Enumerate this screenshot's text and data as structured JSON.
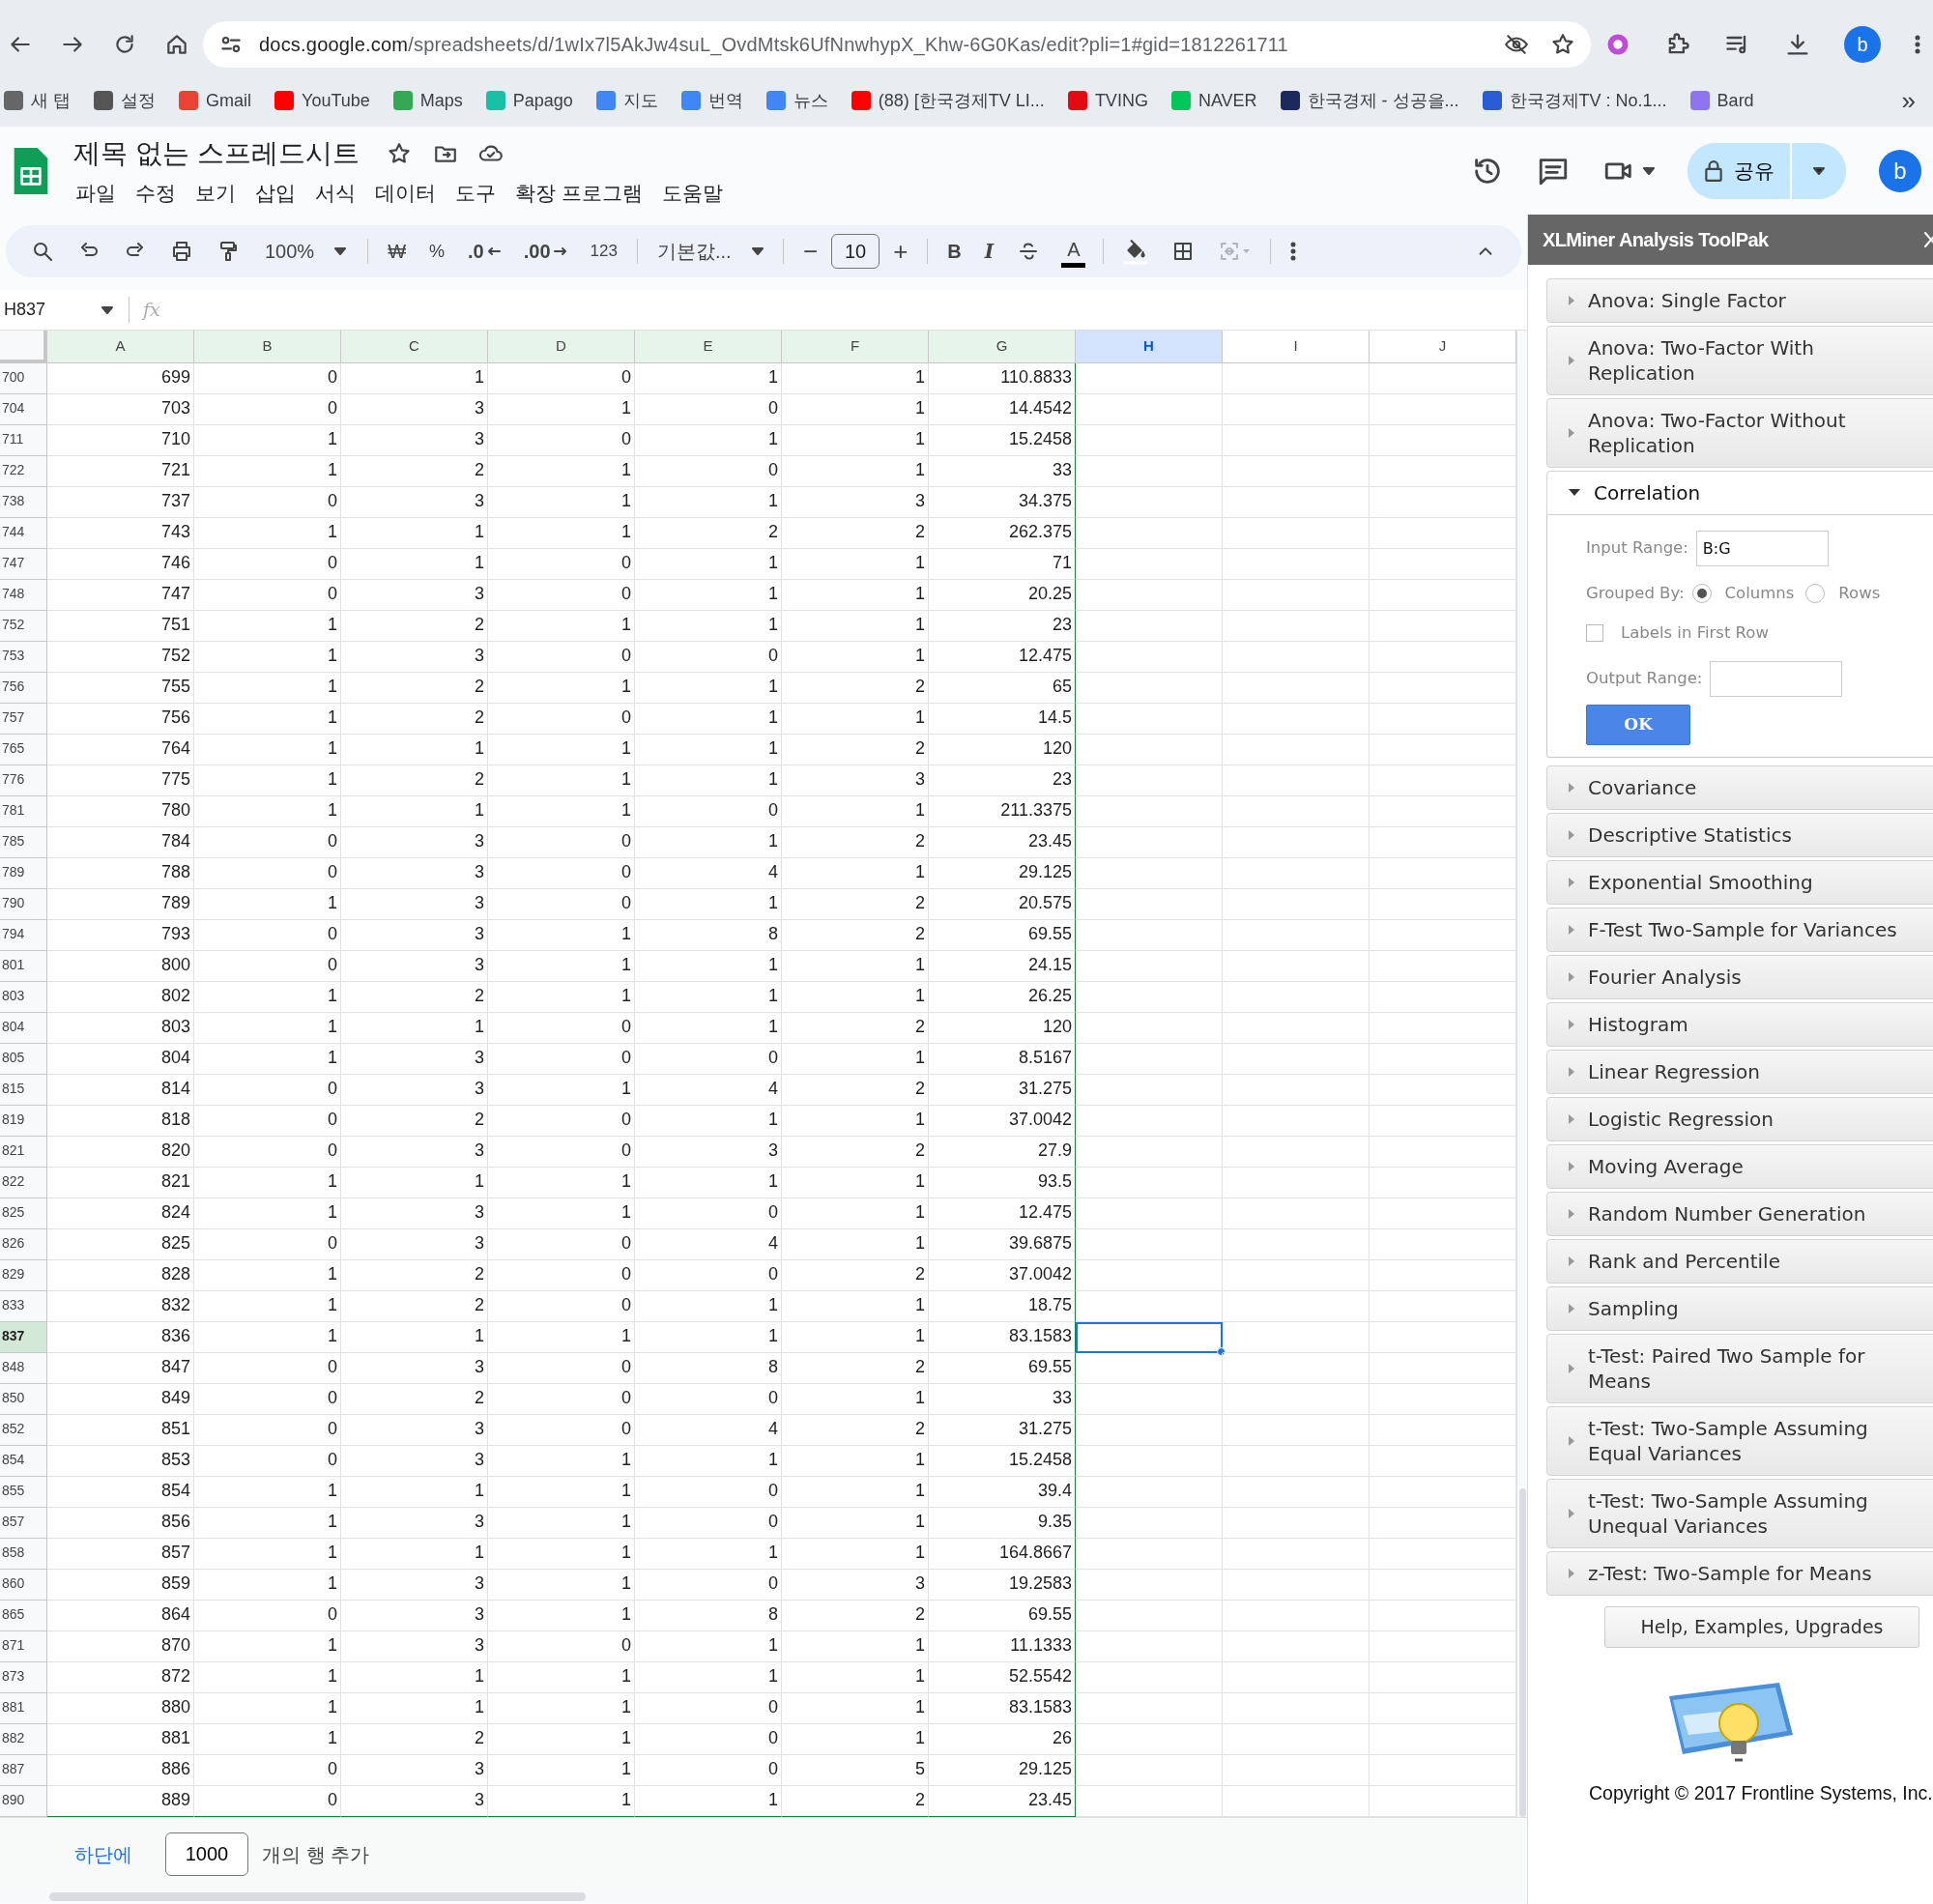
{
  "browser": {
    "url_host": "docs.google.com",
    "url_path": "/spreadsheets/d/1wIx7l5AkJw4suL_OvdMtsk6UfNnwhypX_Khw-6G0Kas/edit?pli=1#gid=1812261711",
    "profile": "b",
    "bookmarks": [
      {
        "label": "새 탭"
      },
      {
        "label": "설정"
      },
      {
        "label": "Gmail"
      },
      {
        "label": "YouTube"
      },
      {
        "label": "Maps"
      },
      {
        "label": "Papago"
      },
      {
        "label": "지도"
      },
      {
        "label": "번역"
      },
      {
        "label": "뉴스"
      },
      {
        "label": "(88) [한국경제TV LI..."
      },
      {
        "label": "TVING"
      },
      {
        "label": "NAVER"
      },
      {
        "label": "한국경제 - 성공을..."
      },
      {
        "label": "한국경제TV : No.1..."
      },
      {
        "label": "Bard"
      }
    ],
    "more": "»"
  },
  "document": {
    "title": "제목 없는 스프레드시트",
    "menu": [
      "파일",
      "수정",
      "보기",
      "삽입",
      "서식",
      "데이터",
      "도구",
      "확장 프로그램",
      "도움말"
    ],
    "share": "공유",
    "avatar": "b"
  },
  "toolbar": {
    "zoom": "100%",
    "currency": "₩",
    "percent": "%",
    "decrease_decimal": ".0",
    "increase_decimal": ".00",
    "number_format": "123",
    "font": "기본값...",
    "minus": "−",
    "font_size": "10",
    "plus": "+",
    "bold": "B",
    "italic": "I",
    "text_color": "A",
    "merge": {
      "disabled": true
    }
  },
  "formula_bar": {
    "cell": "H837",
    "fx": "fx"
  },
  "sheet": {
    "columns": [
      {
        "label": "A",
        "selected": false,
        "filtered": true
      },
      {
        "label": "B",
        "selected": false,
        "filtered": true
      },
      {
        "label": "C",
        "selected": false,
        "filtered": true
      },
      {
        "label": "D",
        "selected": false,
        "filtered": true
      },
      {
        "label": "E",
        "selected": false,
        "filtered": true
      },
      {
        "label": "F",
        "selected": false,
        "filtered": true
      },
      {
        "label": "G",
        "selected": false,
        "filtered": true
      },
      {
        "label": "H",
        "selected": true,
        "filtered": false
      },
      {
        "label": "I",
        "selected": false,
        "filtered": false
      },
      {
        "label": "J",
        "selected": false,
        "filtered": false
      }
    ],
    "rows": [
      {
        "header": "700",
        "selected": false,
        "cells": [
          "699",
          "0",
          "1",
          "0",
          "1",
          "1",
          "110.8833"
        ]
      },
      {
        "header": "704",
        "selected": false,
        "cells": [
          "703",
          "0",
          "3",
          "1",
          "0",
          "1",
          "14.4542"
        ]
      },
      {
        "header": "711",
        "selected": false,
        "cells": [
          "710",
          "1",
          "3",
          "0",
          "1",
          "1",
          "15.2458"
        ]
      },
      {
        "header": "722",
        "selected": false,
        "cells": [
          "721",
          "1",
          "2",
          "1",
          "0",
          "1",
          "33"
        ]
      },
      {
        "header": "738",
        "selected": false,
        "cells": [
          "737",
          "0",
          "3",
          "1",
          "1",
          "3",
          "34.375"
        ]
      },
      {
        "header": "744",
        "selected": false,
        "cells": [
          "743",
          "1",
          "1",
          "1",
          "2",
          "2",
          "262.375"
        ]
      },
      {
        "header": "747",
        "selected": false,
        "cells": [
          "746",
          "0",
          "1",
          "0",
          "1",
          "1",
          "71"
        ]
      },
      {
        "header": "748",
        "selected": false,
        "cells": [
          "747",
          "0",
          "3",
          "0",
          "1",
          "1",
          "20.25"
        ]
      },
      {
        "header": "752",
        "selected": false,
        "cells": [
          "751",
          "1",
          "2",
          "1",
          "1",
          "1",
          "23"
        ]
      },
      {
        "header": "753",
        "selected": false,
        "cells": [
          "752",
          "1",
          "3",
          "0",
          "0",
          "1",
          "12.475"
        ]
      },
      {
        "header": "756",
        "selected": false,
        "cells": [
          "755",
          "1",
          "2",
          "1",
          "1",
          "2",
          "65"
        ]
      },
      {
        "header": "757",
        "selected": false,
        "cells": [
          "756",
          "1",
          "2",
          "0",
          "1",
          "1",
          "14.5"
        ]
      },
      {
        "header": "765",
        "selected": false,
        "cells": [
          "764",
          "1",
          "1",
          "1",
          "1",
          "2",
          "120"
        ]
      },
      {
        "header": "776",
        "selected": false,
        "cells": [
          "775",
          "1",
          "2",
          "1",
          "1",
          "3",
          "23"
        ]
      },
      {
        "header": "781",
        "selected": false,
        "cells": [
          "780",
          "1",
          "1",
          "1",
          "0",
          "1",
          "211.3375"
        ]
      },
      {
        "header": "785",
        "selected": false,
        "cells": [
          "784",
          "0",
          "3",
          "0",
          "1",
          "2",
          "23.45"
        ]
      },
      {
        "header": "789",
        "selected": false,
        "cells": [
          "788",
          "0",
          "3",
          "0",
          "4",
          "1",
          "29.125"
        ]
      },
      {
        "header": "790",
        "selected": false,
        "cells": [
          "789",
          "1",
          "3",
          "0",
          "1",
          "2",
          "20.575"
        ]
      },
      {
        "header": "794",
        "selected": false,
        "cells": [
          "793",
          "0",
          "3",
          "1",
          "8",
          "2",
          "69.55"
        ]
      },
      {
        "header": "801",
        "selected": false,
        "cells": [
          "800",
          "0",
          "3",
          "1",
          "1",
          "1",
          "24.15"
        ]
      },
      {
        "header": "803",
        "selected": false,
        "cells": [
          "802",
          "1",
          "2",
          "1",
          "1",
          "1",
          "26.25"
        ]
      },
      {
        "header": "804",
        "selected": false,
        "cells": [
          "803",
          "1",
          "1",
          "0",
          "1",
          "2",
          "120"
        ]
      },
      {
        "header": "805",
        "selected": false,
        "cells": [
          "804",
          "1",
          "3",
          "0",
          "0",
          "1",
          "8.5167"
        ]
      },
      {
        "header": "815",
        "selected": false,
        "cells": [
          "814",
          "0",
          "3",
          "1",
          "4",
          "2",
          "31.275"
        ]
      },
      {
        "header": "819",
        "selected": false,
        "cells": [
          "818",
          "0",
          "2",
          "0",
          "1",
          "1",
          "37.0042"
        ]
      },
      {
        "header": "821",
        "selected": false,
        "cells": [
          "820",
          "0",
          "3",
          "0",
          "3",
          "2",
          "27.9"
        ]
      },
      {
        "header": "822",
        "selected": false,
        "cells": [
          "821",
          "1",
          "1",
          "1",
          "1",
          "1",
          "93.5"
        ]
      },
      {
        "header": "825",
        "selected": false,
        "cells": [
          "824",
          "1",
          "3",
          "1",
          "0",
          "1",
          "12.475"
        ]
      },
      {
        "header": "826",
        "selected": false,
        "cells": [
          "825",
          "0",
          "3",
          "0",
          "4",
          "1",
          "39.6875"
        ]
      },
      {
        "header": "829",
        "selected": false,
        "cells": [
          "828",
          "1",
          "2",
          "0",
          "0",
          "2",
          "37.0042"
        ]
      },
      {
        "header": "833",
        "selected": false,
        "cells": [
          "832",
          "1",
          "2",
          "0",
          "1",
          "1",
          "18.75"
        ]
      },
      {
        "header": "837",
        "selected": true,
        "cells": [
          "836",
          "1",
          "1",
          "1",
          "1",
          "1",
          "83.1583"
        ]
      },
      {
        "header": "848",
        "selected": false,
        "cells": [
          "847",
          "0",
          "3",
          "0",
          "8",
          "2",
          "69.55"
        ]
      },
      {
        "header": "850",
        "selected": false,
        "cells": [
          "849",
          "0",
          "2",
          "0",
          "0",
          "1",
          "33"
        ]
      },
      {
        "header": "852",
        "selected": false,
        "cells": [
          "851",
          "0",
          "3",
          "0",
          "4",
          "2",
          "31.275"
        ]
      },
      {
        "header": "854",
        "selected": false,
        "cells": [
          "853",
          "0",
          "3",
          "1",
          "1",
          "1",
          "15.2458"
        ]
      },
      {
        "header": "855",
        "selected": false,
        "cells": [
          "854",
          "1",
          "1",
          "1",
          "0",
          "1",
          "39.4"
        ]
      },
      {
        "header": "857",
        "selected": false,
        "cells": [
          "856",
          "1",
          "3",
          "1",
          "0",
          "1",
          "9.35"
        ]
      },
      {
        "header": "858",
        "selected": false,
        "cells": [
          "857",
          "1",
          "1",
          "1",
          "1",
          "1",
          "164.8667"
        ]
      },
      {
        "header": "860",
        "selected": false,
        "cells": [
          "859",
          "1",
          "3",
          "1",
          "0",
          "3",
          "19.2583"
        ]
      },
      {
        "header": "865",
        "selected": false,
        "cells": [
          "864",
          "0",
          "3",
          "1",
          "8",
          "2",
          "69.55"
        ]
      },
      {
        "header": "871",
        "selected": false,
        "cells": [
          "870",
          "1",
          "3",
          "0",
          "1",
          "1",
          "11.1333"
        ]
      },
      {
        "header": "873",
        "selected": false,
        "cells": [
          "872",
          "1",
          "1",
          "1",
          "1",
          "1",
          "52.5542"
        ]
      },
      {
        "header": "881",
        "selected": false,
        "cells": [
          "880",
          "1",
          "1",
          "1",
          "0",
          "1",
          "83.1583"
        ]
      },
      {
        "header": "882",
        "selected": false,
        "cells": [
          "881",
          "1",
          "2",
          "1",
          "0",
          "1",
          "26"
        ]
      },
      {
        "header": "887",
        "selected": false,
        "cells": [
          "886",
          "0",
          "3",
          "1",
          "0",
          "5",
          "29.125"
        ]
      },
      {
        "header": "890",
        "selected": false,
        "cells": [
          "889",
          "0",
          "3",
          "1",
          "1",
          "2",
          "23.45"
        ]
      }
    ]
  },
  "add_rows": {
    "link": "하단에",
    "count": "1000",
    "suffix": "개의 행 추가"
  },
  "panel": {
    "title": "XLMiner Analysis ToolPak",
    "tools": [
      {
        "label": "Anova: Single Factor",
        "expanded": false
      },
      {
        "label": "Anova: Two-Factor With Replication",
        "expanded": false
      },
      {
        "label": "Anova: Two-Factor Without Replication",
        "expanded": false
      },
      {
        "label": "Correlation",
        "expanded": true,
        "form": {
          "input_label": "Input Range:",
          "input_value": "B:G",
          "grouped_label": "Grouped By:",
          "options": [
            {
              "label": "Columns",
              "selected": true
            },
            {
              "label": "Rows",
              "selected": false
            }
          ],
          "labels_first_row": {
            "label": "Labels in First Row",
            "checked": false
          },
          "output_label": "Output Range:",
          "ok": "OK"
        }
      },
      {
        "label": "Covariance",
        "expanded": false
      },
      {
        "label": "Descriptive Statistics",
        "expanded": false
      },
      {
        "label": "Exponential Smoothing",
        "expanded": false
      },
      {
        "label": "F-Test Two-Sample for Variances",
        "expanded": false
      },
      {
        "label": "Fourier Analysis",
        "expanded": false
      },
      {
        "label": "Histogram",
        "expanded": false
      },
      {
        "label": "Linear Regression",
        "expanded": false
      },
      {
        "label": "Logistic Regression",
        "expanded": false
      },
      {
        "label": "Moving Average",
        "expanded": false
      },
      {
        "label": "Random Number Generation",
        "expanded": false
      },
      {
        "label": "Rank and Percentile",
        "expanded": false
      },
      {
        "label": "Sampling",
        "expanded": false
      },
      {
        "label": "t-Test: Paired Two Sample for Means",
        "expanded": false
      },
      {
        "label": "t-Test: Two-Sample Assuming Equal Variances",
        "expanded": false
      },
      {
        "label": "t-Test: Two-Sample Assuming Unequal Variances",
        "expanded": false
      },
      {
        "label": "z-Test: Two-Sample for Means",
        "expanded": false
      }
    ],
    "help": "Help, Examples, Upgrades",
    "copyright": "Copyright © 2017 Frontline Systems, Inc."
  }
}
